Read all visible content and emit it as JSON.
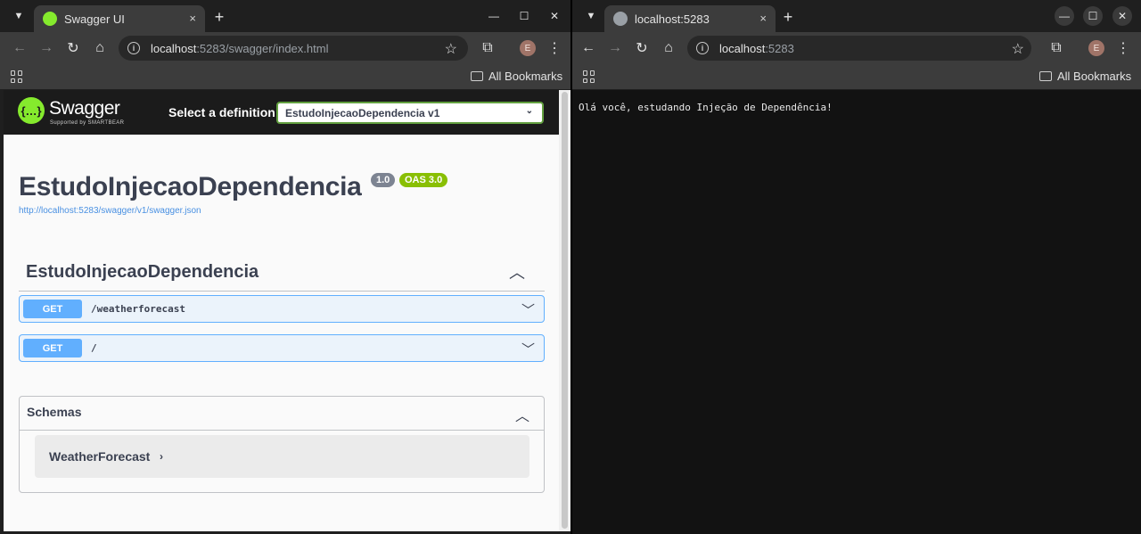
{
  "left_window": {
    "tab": {
      "title": "Swagger UI",
      "close": "×"
    },
    "url": {
      "host": "localhost",
      "rest": ":5283/swagger/index.html"
    },
    "bookmarks": {
      "label": "All Bookmarks"
    },
    "avatar_letter": "E",
    "swagger": {
      "brand": "Swagger",
      "brand_sub": "Supported by SMARTBEAR",
      "select_label": "Select a definition",
      "selected_definition": "EstudoInjecaoDependencia v1",
      "api_title": "EstudoInjecaoDependencia",
      "version_badge": "1.0",
      "oas_badge": "OAS 3.0",
      "spec_url": "http://localhost:5283/swagger/v1/swagger.json",
      "tag": "EstudoInjecaoDependencia",
      "operations": [
        {
          "method": "GET",
          "path": "/weatherforecast"
        },
        {
          "method": "GET",
          "path": "/"
        }
      ],
      "schemas_title": "Schemas",
      "models": [
        "WeatherForecast"
      ]
    }
  },
  "right_window": {
    "tab": {
      "title": "localhost:5283",
      "close": "×"
    },
    "url": {
      "host": "localhost",
      "rest": ":5283"
    },
    "bookmarks": {
      "label": "All Bookmarks"
    },
    "avatar_letter": "E",
    "page_text": "Olá você, estudando Injeção de Dependência!"
  },
  "colors": {
    "swagger_green": "#85ea2d",
    "get_blue": "#61affe",
    "oas_green": "#89bf04"
  }
}
